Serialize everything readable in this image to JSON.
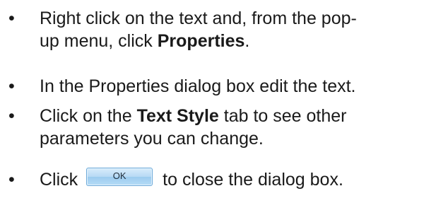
{
  "bullet_glyph": "•",
  "items": [
    {
      "line1": "Right click on the text and, from the pop-",
      "line2_pre": "up menu, click ",
      "line2_bold": "Properties",
      "line2_post": "."
    },
    {
      "text": "In the Properties dialog box edit the text."
    },
    {
      "line1_pre": "Click on the ",
      "line1_bold": "Text Style",
      "line1_post": " tab to see other",
      "line2": "parameters you can change."
    },
    {
      "pre": "Click",
      "button_label": "OK",
      "post": "to close the dialog box."
    }
  ]
}
